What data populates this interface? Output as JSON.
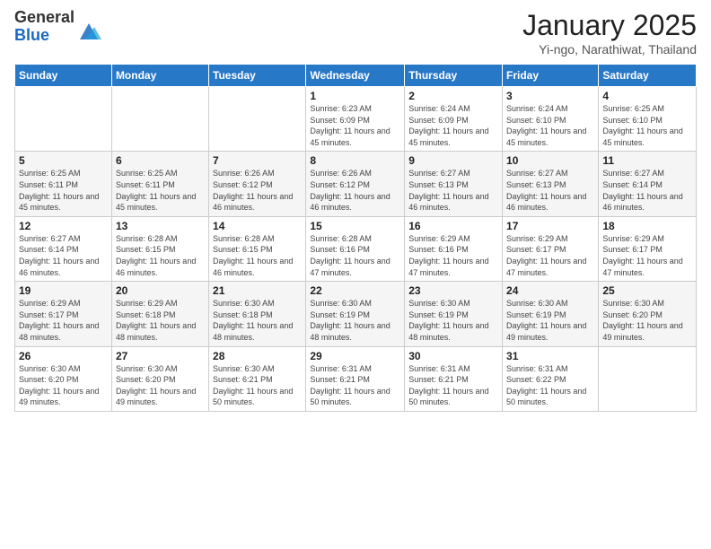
{
  "header": {
    "logo_general": "General",
    "logo_blue": "Blue",
    "month_title": "January 2025",
    "subtitle": "Yi-ngo, Narathiwat, Thailand"
  },
  "days_of_week": [
    "Sunday",
    "Monday",
    "Tuesday",
    "Wednesday",
    "Thursday",
    "Friday",
    "Saturday"
  ],
  "weeks": [
    [
      {
        "num": "",
        "info": ""
      },
      {
        "num": "",
        "info": ""
      },
      {
        "num": "",
        "info": ""
      },
      {
        "num": "1",
        "info": "Sunrise: 6:23 AM\nSunset: 6:09 PM\nDaylight: 11 hours and 45 minutes."
      },
      {
        "num": "2",
        "info": "Sunrise: 6:24 AM\nSunset: 6:09 PM\nDaylight: 11 hours and 45 minutes."
      },
      {
        "num": "3",
        "info": "Sunrise: 6:24 AM\nSunset: 6:10 PM\nDaylight: 11 hours and 45 minutes."
      },
      {
        "num": "4",
        "info": "Sunrise: 6:25 AM\nSunset: 6:10 PM\nDaylight: 11 hours and 45 minutes."
      }
    ],
    [
      {
        "num": "5",
        "info": "Sunrise: 6:25 AM\nSunset: 6:11 PM\nDaylight: 11 hours and 45 minutes."
      },
      {
        "num": "6",
        "info": "Sunrise: 6:25 AM\nSunset: 6:11 PM\nDaylight: 11 hours and 45 minutes."
      },
      {
        "num": "7",
        "info": "Sunrise: 6:26 AM\nSunset: 6:12 PM\nDaylight: 11 hours and 46 minutes."
      },
      {
        "num": "8",
        "info": "Sunrise: 6:26 AM\nSunset: 6:12 PM\nDaylight: 11 hours and 46 minutes."
      },
      {
        "num": "9",
        "info": "Sunrise: 6:27 AM\nSunset: 6:13 PM\nDaylight: 11 hours and 46 minutes."
      },
      {
        "num": "10",
        "info": "Sunrise: 6:27 AM\nSunset: 6:13 PM\nDaylight: 11 hours and 46 minutes."
      },
      {
        "num": "11",
        "info": "Sunrise: 6:27 AM\nSunset: 6:14 PM\nDaylight: 11 hours and 46 minutes."
      }
    ],
    [
      {
        "num": "12",
        "info": "Sunrise: 6:27 AM\nSunset: 6:14 PM\nDaylight: 11 hours and 46 minutes."
      },
      {
        "num": "13",
        "info": "Sunrise: 6:28 AM\nSunset: 6:15 PM\nDaylight: 11 hours and 46 minutes."
      },
      {
        "num": "14",
        "info": "Sunrise: 6:28 AM\nSunset: 6:15 PM\nDaylight: 11 hours and 46 minutes."
      },
      {
        "num": "15",
        "info": "Sunrise: 6:28 AM\nSunset: 6:16 PM\nDaylight: 11 hours and 47 minutes."
      },
      {
        "num": "16",
        "info": "Sunrise: 6:29 AM\nSunset: 6:16 PM\nDaylight: 11 hours and 47 minutes."
      },
      {
        "num": "17",
        "info": "Sunrise: 6:29 AM\nSunset: 6:17 PM\nDaylight: 11 hours and 47 minutes."
      },
      {
        "num": "18",
        "info": "Sunrise: 6:29 AM\nSunset: 6:17 PM\nDaylight: 11 hours and 47 minutes."
      }
    ],
    [
      {
        "num": "19",
        "info": "Sunrise: 6:29 AM\nSunset: 6:17 PM\nDaylight: 11 hours and 48 minutes."
      },
      {
        "num": "20",
        "info": "Sunrise: 6:29 AM\nSunset: 6:18 PM\nDaylight: 11 hours and 48 minutes."
      },
      {
        "num": "21",
        "info": "Sunrise: 6:30 AM\nSunset: 6:18 PM\nDaylight: 11 hours and 48 minutes."
      },
      {
        "num": "22",
        "info": "Sunrise: 6:30 AM\nSunset: 6:19 PM\nDaylight: 11 hours and 48 minutes."
      },
      {
        "num": "23",
        "info": "Sunrise: 6:30 AM\nSunset: 6:19 PM\nDaylight: 11 hours and 48 minutes."
      },
      {
        "num": "24",
        "info": "Sunrise: 6:30 AM\nSunset: 6:19 PM\nDaylight: 11 hours and 49 minutes."
      },
      {
        "num": "25",
        "info": "Sunrise: 6:30 AM\nSunset: 6:20 PM\nDaylight: 11 hours and 49 minutes."
      }
    ],
    [
      {
        "num": "26",
        "info": "Sunrise: 6:30 AM\nSunset: 6:20 PM\nDaylight: 11 hours and 49 minutes."
      },
      {
        "num": "27",
        "info": "Sunrise: 6:30 AM\nSunset: 6:20 PM\nDaylight: 11 hours and 49 minutes."
      },
      {
        "num": "28",
        "info": "Sunrise: 6:30 AM\nSunset: 6:21 PM\nDaylight: 11 hours and 50 minutes."
      },
      {
        "num": "29",
        "info": "Sunrise: 6:31 AM\nSunset: 6:21 PM\nDaylight: 11 hours and 50 minutes."
      },
      {
        "num": "30",
        "info": "Sunrise: 6:31 AM\nSunset: 6:21 PM\nDaylight: 11 hours and 50 minutes."
      },
      {
        "num": "31",
        "info": "Sunrise: 6:31 AM\nSunset: 6:22 PM\nDaylight: 11 hours and 50 minutes."
      },
      {
        "num": "",
        "info": ""
      }
    ]
  ]
}
